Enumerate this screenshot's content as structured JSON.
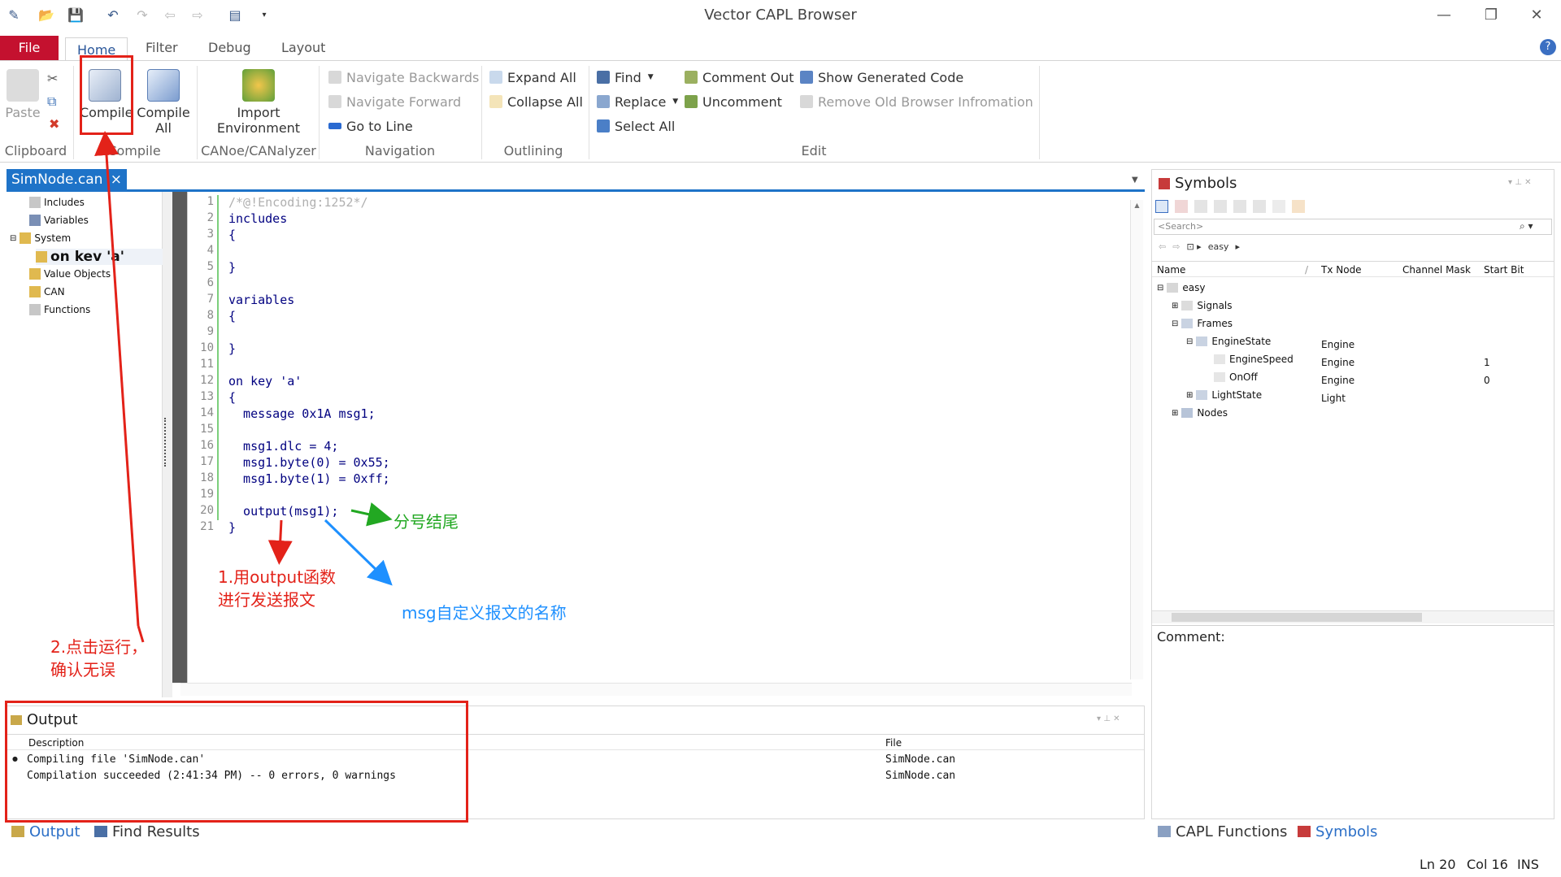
{
  "window": {
    "title": "Vector CAPL Browser"
  },
  "menu": {
    "file": "File",
    "tabs": [
      "Home",
      "Filter",
      "Debug",
      "Layout"
    ]
  },
  "ribbon": {
    "clipboard": {
      "paste": "Paste",
      "group": "Clipboard"
    },
    "compile": {
      "compile": "Compile",
      "compile_all_1": "Compile",
      "compile_all_2": "All",
      "group": "Compile"
    },
    "canoe": {
      "import_1": "Import",
      "import_2": "Environment",
      "group": "CANoe/CANalyzer"
    },
    "navigation": {
      "back": "Navigate Backwards",
      "forward": "Navigate Forward",
      "goto": "Go to Line",
      "group": "Navigation"
    },
    "outlining": {
      "expand": "Expand All",
      "collapse": "Collapse All",
      "group": "Outlining"
    },
    "edit": {
      "find": "Find",
      "replace": "Replace",
      "select_all": "Select All",
      "comment_out": "Comment Out",
      "uncomment": "Uncomment",
      "show_generated": "Show Generated Code",
      "remove_old": "Remove Old Browser Infromation",
      "group": "Edit"
    }
  },
  "document": {
    "tab": "SimNode.can",
    "close": "×"
  },
  "tree": [
    "Includes",
    "Variables",
    "System",
    "on kev 'a'",
    "Value Objects",
    "CAN",
    "Functions"
  ],
  "code_lines": [
    {
      "n": "1",
      "text": "/*@!Encoding:1252*/",
      "comment": true
    },
    {
      "n": "2",
      "text": "includes"
    },
    {
      "n": "3",
      "text": "{"
    },
    {
      "n": "4",
      "text": ""
    },
    {
      "n": "5",
      "text": "}"
    },
    {
      "n": "6",
      "text": ""
    },
    {
      "n": "7",
      "text": "variables"
    },
    {
      "n": "8",
      "text": "{"
    },
    {
      "n": "9",
      "text": ""
    },
    {
      "n": "10",
      "text": "}"
    },
    {
      "n": "11",
      "text": ""
    },
    {
      "n": "12",
      "text": "on key 'a'"
    },
    {
      "n": "13",
      "text": "{"
    },
    {
      "n": "14",
      "text": "  message 0x1A msg1;"
    },
    {
      "n": "15",
      "text": ""
    },
    {
      "n": "16",
      "text": "  msg1.dlc = 4;"
    },
    {
      "n": "17",
      "text": "  msg1.byte(0) = 0x55;"
    },
    {
      "n": "18",
      "text": "  msg1.byte(1) = 0xff;"
    },
    {
      "n": "19",
      "text": ""
    },
    {
      "n": "20",
      "text": "  output(msg1);"
    },
    {
      "n": "21",
      "text": "}"
    }
  ],
  "symbols": {
    "title": "Symbols",
    "search_placeholder": "<Search>",
    "breadcrumb": "easy",
    "columns": [
      "Name",
      "Tx Node",
      "Channel Mask",
      "Start Bit"
    ],
    "tree": [
      {
        "name": "easy",
        "tx": "",
        "start": ""
      },
      {
        "name": "Signals",
        "tx": "",
        "start": ""
      },
      {
        "name": "Frames",
        "tx": "",
        "start": ""
      },
      {
        "name": "EngineState",
        "tx": "Engine",
        "start": ""
      },
      {
        "name": "EngineSpeed",
        "tx": "Engine",
        "start": "1"
      },
      {
        "name": "OnOff",
        "tx": "Engine",
        "start": "0"
      },
      {
        "name": "LightState",
        "tx": "Light",
        "start": ""
      },
      {
        "name": "Nodes",
        "tx": "",
        "start": ""
      }
    ],
    "comment_label": "Comment:"
  },
  "output": {
    "title": "Output",
    "columns": [
      "Description",
      "File"
    ],
    "rows": [
      {
        "desc": "Compiling file 'SimNode.can'",
        "file": "SimNode.can"
      },
      {
        "desc": "Compilation succeeded (2:41:34 PM) -- 0 errors, 0 warnings",
        "file": "SimNode.can"
      }
    ]
  },
  "bottom_tabs": {
    "left": [
      "Output",
      "Find Results"
    ],
    "right": [
      "CAPL Functions",
      "Symbols"
    ]
  },
  "status": {
    "ln": "Ln 20",
    "col": "Col 16",
    "mode": "INS"
  },
  "annotations": {
    "semicolon": "分号结尾",
    "output_fn_1": "1.用output函数",
    "output_fn_2": "进行发送报文",
    "msg_name": "msg自定义报文的名称",
    "click_run_1": "2.点击运行，",
    "click_run_2": "确认无误"
  },
  "colors": {
    "file_tab": "#c4112f",
    "doc_tab": "#1e73c8",
    "annotation_red": "#e32219",
    "annotation_green": "#22a822",
    "annotation_blue": "#1e90ff"
  }
}
